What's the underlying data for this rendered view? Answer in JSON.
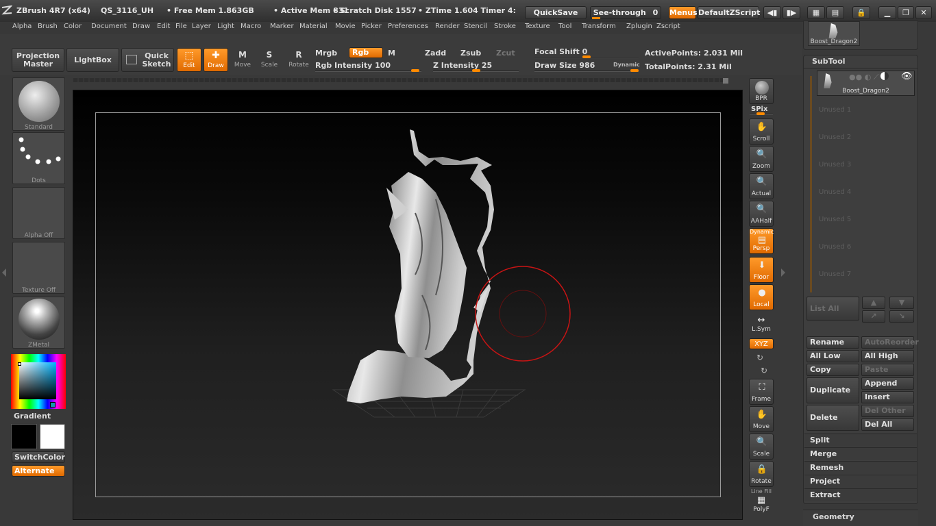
{
  "titlebar": {
    "app": "ZBrush 4R7 (x64)",
    "doc": "QS_3116_UH",
    "free_mem": "• Free Mem 1.863GB",
    "active_mem": "• Active Mem 831",
    "scratch": "• Scratch Disk 1557",
    "ztime": "• ZTime 1.604 Timer 4:",
    "quicksave": "QuickSave",
    "seethrough": "See-through",
    "seethrough_val": "0",
    "menus": "Menus",
    "defaultzscript": "DefaultZScript"
  },
  "menus": [
    "Alpha",
    "Brush",
    "Color",
    "Document",
    "Draw",
    "Edit",
    "File",
    "Layer",
    "Light",
    "Macro",
    "Marker",
    "Material",
    "Movie",
    "Picker",
    "Preferences",
    "Render",
    "Stencil",
    "Stroke",
    "Texture",
    "Tool",
    "Transform",
    "Zplugin",
    "Zscript"
  ],
  "shelf": {
    "projection_master_1": "Projection",
    "projection_master_2": "Master",
    "lightbox": "LightBox",
    "quick_sketch_1": "Quick",
    "quick_sketch_2": "Sketch",
    "edit": "Edit",
    "draw": "Draw",
    "move": "Move",
    "scale": "Scale",
    "rotate": "Rotate",
    "mrgb": "Mrgb",
    "rgb": "Rgb",
    "m": "M",
    "zadd": "Zadd",
    "zsub": "Zsub",
    "zcut": "Zcut",
    "rgb_intensity": "Rgb Intensity 100",
    "rgb_intensity_value": 100,
    "z_intensity": "Z Intensity 25",
    "z_intensity_value": 25,
    "focal_shift": "Focal Shift 0",
    "focal_shift_value": 0,
    "draw_size": "Draw Size 986",
    "draw_size_value": 986,
    "dynamic": "Dynamic",
    "active_points": "ActivePoints: 2.031 Mil",
    "total_points": "TotalPoints: 2.31 Mil"
  },
  "left": {
    "brush": "Standard",
    "stroke": "Dots",
    "alpha": "Alpha  Off",
    "texture": "Texture  Off",
    "material": "ZMetal",
    "gradient": "Gradient",
    "switchcolor": "SwitchColor",
    "alternate": "Alternate",
    "main_color": "#000000",
    "secondary_color": "#ffffff"
  },
  "rshelf": {
    "bpr": "BPR",
    "spix": "SPix",
    "scroll": "Scroll",
    "zoom": "Zoom",
    "actual": "Actual",
    "aahalf": "AAHalf",
    "dynamic": "Dynamic",
    "persp": "Persp",
    "floor": "Floor",
    "local": "Local",
    "lsym": "L.Sym",
    "xyz": "XYZ",
    "frame": "Frame",
    "move": "Move",
    "scale": "Scale",
    "rotate": "Rotate",
    "linefill": "Line Fill",
    "polyf": "PolyF"
  },
  "subtool": {
    "top_thumb_label": "Boost_Dragon2",
    "title": "SubTool",
    "active": "Boost_Dragon2",
    "unused": [
      "Unused  1",
      "Unused  2",
      "Unused  3",
      "Unused  4",
      "Unused  5",
      "Unused  6",
      "Unused  7"
    ],
    "list_all": "List  All",
    "rename": "Rename",
    "autoreorder": "AutoReorder",
    "all_low": "All Low",
    "all_high": "All High",
    "copy": "Copy",
    "paste": "Paste",
    "duplicate": "Duplicate",
    "append": "Append",
    "insert": "Insert",
    "delete": "Delete",
    "del_other": "Del Other",
    "del_all": "Del  All",
    "split": "Split",
    "merge": "Merge",
    "remesh": "Remesh",
    "project": "Project",
    "extract": "Extract",
    "geometry": "Geometry"
  },
  "colors": {
    "accent": "#ff8a00",
    "cursor": "#c81414"
  }
}
